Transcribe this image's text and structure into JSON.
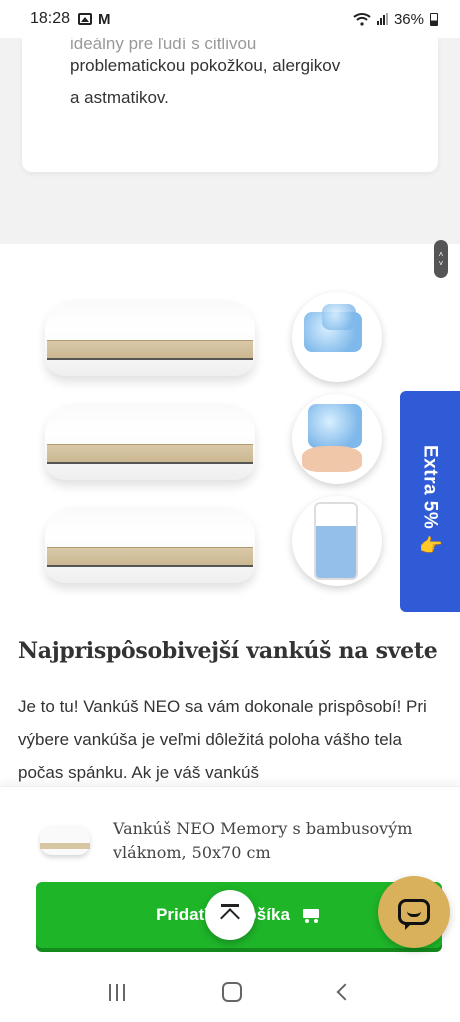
{
  "status_bar": {
    "time": "18:28",
    "battery": "36%"
  },
  "feature_card": {
    "lines": [
      "problematickou pokožkou, alergikov",
      "a astmatikov."
    ],
    "cut_off_line": "ideálny pre ľudí s citlivou"
  },
  "product_image": {
    "alt": "Vankúš NEO Memory pillows and filling"
  },
  "extra_tab": {
    "label": "Extra 5% 👉"
  },
  "content": {
    "heading": "Najprispôsobivejší vankúš na svete",
    "paragraph": "Je to tu! Vankúš NEO sa vám dokonale prispôsobí! Pri výbere vankúša je veľmi dôležitá poloha vášho tela počas spánku. Ak je váš vankúš"
  },
  "sticky_bar": {
    "product_title": "Vankúš NEO Memory s bambusovým vláknom, 50x70 cm",
    "add_to_cart_label": "Pridať do košíka"
  }
}
